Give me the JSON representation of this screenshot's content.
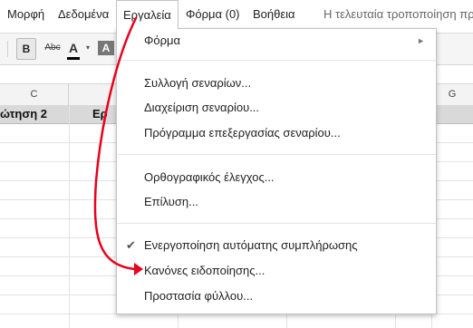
{
  "menubar": {
    "items": [
      "Μορφή",
      "Δεδομένα",
      "Εργαλεία",
      "Φόρμα (0)",
      "Βοήθεια"
    ],
    "status": "Η τελευταία τροποποίηση πρ"
  },
  "toolbar": {
    "bold": "B",
    "strike": "Abc",
    "text_color": "A",
    "caret": "▾",
    "highlight": "A"
  },
  "sheet": {
    "columns": [
      "C",
      "G"
    ],
    "row2": [
      "ώτηση 2",
      "Ερ"
    ]
  },
  "menu": {
    "form": {
      "label": "Φόρμα",
      "arrow": "►"
    },
    "scenario_collection": "Συλλογή σεναρίων...",
    "scenario_manage": "Διαχείριση σεναρίου...",
    "scenario_editor": "Πρόγραμμα επεξεργασίας σεναρίου...",
    "spellcheck": "Ορθογραφικός έλεγχος...",
    "solve": "Επίλυση...",
    "autocomplete": {
      "check": "✔",
      "label": "Ενεργοποίηση αυτόματης συμπλήρωσης"
    },
    "notification_rules": "Κανόνες ειδοποίησης...",
    "protect_sheet": "Προστασία φύλλου..."
  },
  "colors": {
    "annotation_arrow": "#e8001c",
    "menu_border": "#c4c4c4",
    "header_row": "#d9d9d9"
  }
}
